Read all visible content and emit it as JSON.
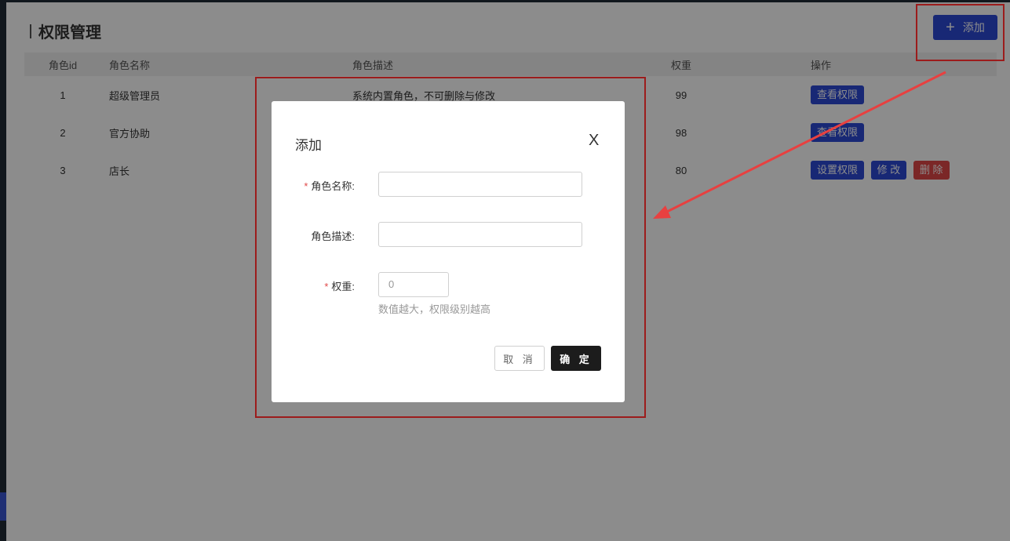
{
  "page": {
    "title": "权限管理",
    "add_button": "添加"
  },
  "table": {
    "headers": [
      "角色id",
      "角色名称",
      "角色描述",
      "权重",
      "操作"
    ],
    "rows": [
      {
        "id": "1",
        "name": "超级管理员",
        "desc": "系统内置角色，不可删除与修改",
        "weight": "99",
        "ops": [
          "查看权限"
        ]
      },
      {
        "id": "2",
        "name": "官方协助",
        "desc": "",
        "weight": "98",
        "ops": [
          "查看权限"
        ]
      },
      {
        "id": "3",
        "name": "店长",
        "desc": "",
        "weight": "80",
        "ops": [
          "设置权限",
          "修 改",
          "删 除"
        ]
      }
    ]
  },
  "modal": {
    "title": "添加",
    "close_symbol": "X",
    "required_mark": "*",
    "fields": {
      "name_label": "角色名称:",
      "desc_label": "角色描述:",
      "weight_label": "权重:",
      "weight_value": "0",
      "weight_hint": "数值越大，权限级别越高"
    },
    "cancel": "取 消",
    "confirm": "确 定"
  },
  "colors": {
    "primary": "#2d49d6",
    "danger": "#e04848",
    "dark": "#1c1c1c",
    "annotation": "#9c1c1c",
    "arrow": "#e84040"
  }
}
